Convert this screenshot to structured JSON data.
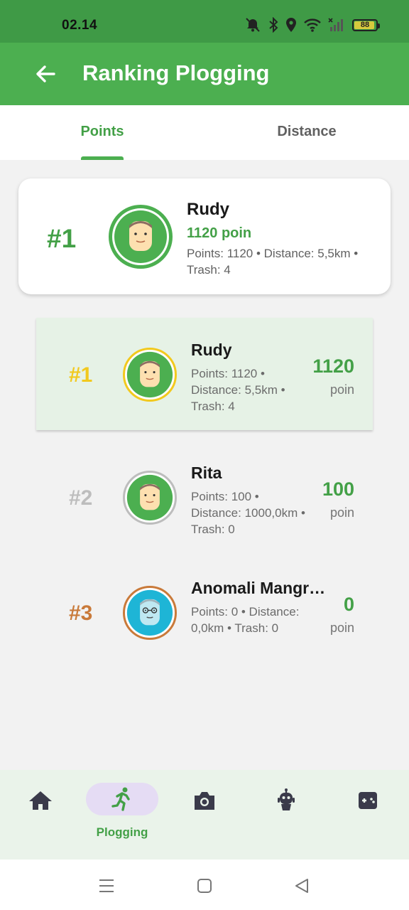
{
  "status_bar": {
    "time": "02.14",
    "battery": "88"
  },
  "app_bar": {
    "title": "Ranking Plogging"
  },
  "tabs": [
    {
      "label": "Points",
      "active": true
    },
    {
      "label": "Distance",
      "active": false
    }
  ],
  "top_card": {
    "rank": "#1",
    "name": "Rudy",
    "poin": "1120 poin",
    "detail": "Points: 1120 • Distance: 5,5km • Trash: 4"
  },
  "ranking": [
    {
      "rank": "#1",
      "name": "Rudy",
      "detail": "Points: 1120 • Distance: 5,5km • Trash: 4",
      "points": "1120",
      "unit": "poin",
      "rank_color": "#f2c91e",
      "ring_color": "#f2c91e"
    },
    {
      "rank": "#2",
      "name": "Rita",
      "detail": "Points: 100 • Distance: 1000,0km • Trash: 0",
      "points": "100",
      "unit": "poin",
      "rank_color": "#bdbdbd",
      "ring_color": "#bdbdbd"
    },
    {
      "rank": "#3",
      "name": "Anomali Mangrove",
      "detail": "Points: 0 • Distance: 0,0km • Trash: 0",
      "points": "0",
      "unit": "poin",
      "rank_color": "#c97a3a",
      "ring_color": "#c97a3a"
    }
  ],
  "bottom_nav": {
    "items": [
      {
        "icon": "home-icon",
        "label": ""
      },
      {
        "icon": "running-icon",
        "label": "Plogging",
        "active": true
      },
      {
        "icon": "camera-icon",
        "label": ""
      },
      {
        "icon": "robot-icon",
        "label": ""
      },
      {
        "icon": "gamepad-icon",
        "label": ""
      }
    ]
  },
  "colors": {
    "primary": "#4caf50",
    "status_bar": "#3f9a46",
    "accent_text": "#43a047"
  }
}
